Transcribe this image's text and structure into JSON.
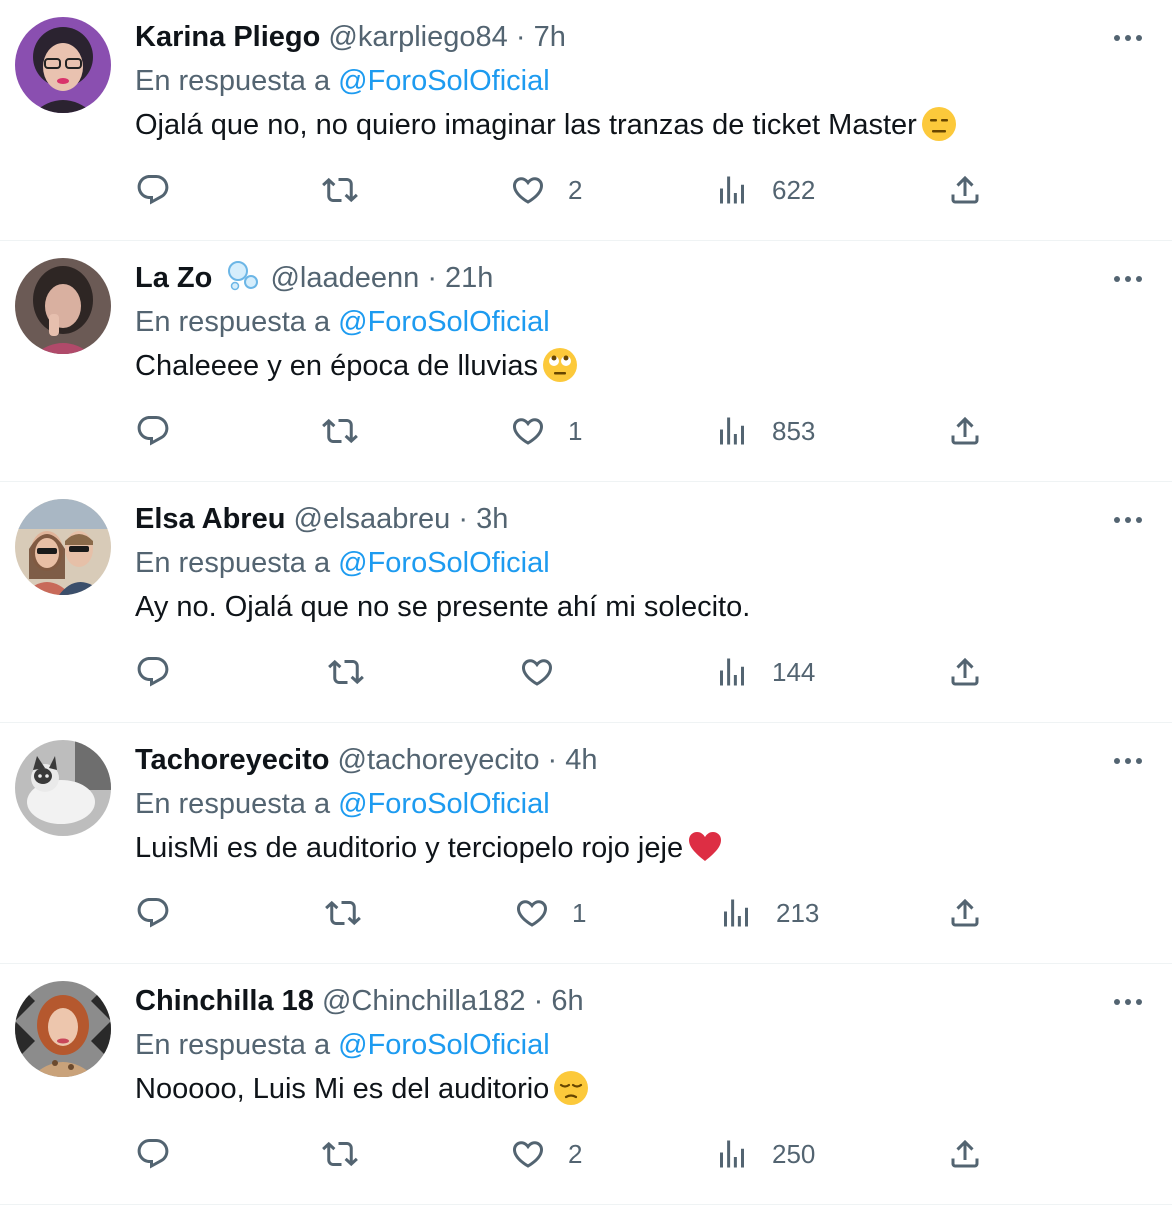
{
  "reply_prefix": "En respuesta a ",
  "tweets": [
    {
      "name": "Karina Pliego",
      "handle": "@karpliego84",
      "separator": "·",
      "time": "7h",
      "reply_to": "@ForoSolOficial",
      "text": "Ojalá que no, no quiero imaginar las tranzas de ticket Master",
      "emoji": "expressionless-face",
      "likes": "2",
      "views": "622"
    },
    {
      "name": "La Zo",
      "name_badge": "bubbles-emoji",
      "handle": "@laadeenn",
      "separator": "·",
      "time": "21h",
      "reply_to": "@ForoSolOficial",
      "text": "Chaleeee y en época de lluvias",
      "emoji": "face-with-rolling-eyes",
      "likes": "1",
      "views": "853"
    },
    {
      "name": "Elsa Abreu",
      "handle": "@elsaabreu",
      "separator": "·",
      "time": "3h",
      "reply_to": "@ForoSolOficial",
      "text": "Ay no. Ojalá que no se presente ahí mi solecito.",
      "likes": "",
      "views": "144"
    },
    {
      "name": "Tachoreyecito",
      "handle": "@tachoreyecito",
      "separator": "·",
      "time": "4h",
      "reply_to": "@ForoSolOficial",
      "text": "LuisMi es de auditorio y terciopelo rojo jeje",
      "emoji": "red-heart",
      "likes": "1",
      "views": "213"
    },
    {
      "name": "Chinchilla 18",
      "handle": "@Chinchilla182",
      "separator": "·",
      "time": "6h",
      "reply_to": "@ForoSolOficial",
      "text": "Nooooo, Luis Mi es del auditorio",
      "emoji": "pensive-face",
      "likes": "2",
      "views": "250"
    }
  ],
  "colors": {
    "text": "#0f1419",
    "secondary": "#536471",
    "link": "#1d9bf0",
    "divider": "#eff3f4"
  },
  "icons": [
    "reply-icon",
    "retweet-icon",
    "like-icon",
    "views-icon",
    "share-icon",
    "more-icon"
  ]
}
